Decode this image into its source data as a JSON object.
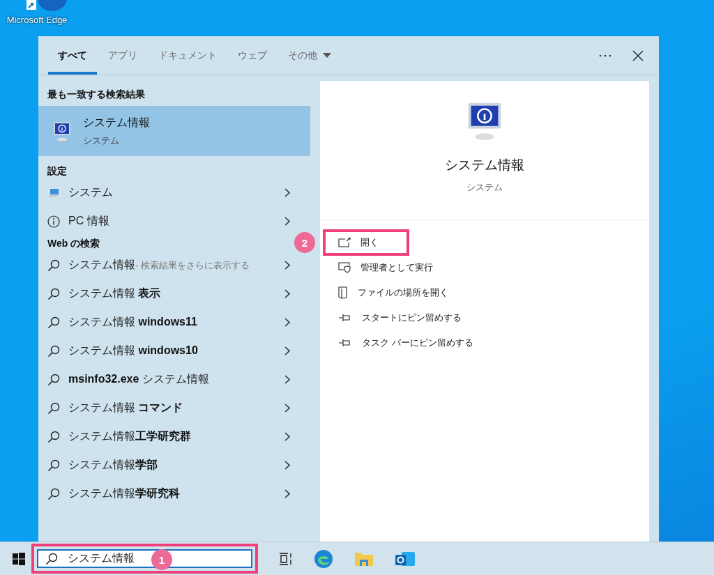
{
  "desktop_icon": {
    "label": "Microsoft Edge"
  },
  "tabs": [
    {
      "label": "すべて",
      "selected": true,
      "kind": "plain"
    },
    {
      "label": "アプリ",
      "selected": false,
      "kind": "plain"
    },
    {
      "label": "ドキュメント",
      "selected": false,
      "kind": "plain"
    },
    {
      "label": "ウェブ",
      "selected": false,
      "kind": "plain"
    },
    {
      "label": "その他",
      "selected": false,
      "kind": "dropdown"
    }
  ],
  "best_match": {
    "heading": "最も一致する検索結果",
    "title": "システム情報",
    "subtitle": "システム",
    "selected": true
  },
  "settings": {
    "heading": "設定",
    "items": [
      {
        "label": "システム",
        "kind": "laptop"
      },
      {
        "label": "PC 情報",
        "kind": "info"
      }
    ]
  },
  "web_search": {
    "heading": "Web の検索",
    "items": [
      {
        "text": "システム情報",
        "hint": "- 検索結果をさらに表示する"
      },
      {
        "text": "システム情報 **表示**"
      },
      {
        "text": "システム情報 **windows11**"
      },
      {
        "text": "システム情報 **windows10**"
      },
      {
        "text": "**msinfo32.exe** システム情報"
      },
      {
        "text": "システム情報 **コマンド**"
      },
      {
        "text": "システム情報**工学研究群**"
      },
      {
        "text": "システム情報**学部**"
      },
      {
        "text": "システム情報**学研究科**"
      }
    ]
  },
  "preview": {
    "title": "システム情報",
    "subtitle": "システム",
    "actions": [
      {
        "label": "開く",
        "kind": "open",
        "highlighted": true,
        "annotation": "2"
      },
      {
        "label": "管理者として実行",
        "kind": "admin",
        "highlighted": false
      },
      {
        "label": "ファイルの場所を開く",
        "kind": "folder",
        "highlighted": false
      },
      {
        "label": "スタートにピン留めする",
        "kind": "pin",
        "highlighted": false
      },
      {
        "label": "タスク バーにピン留めする",
        "kind": "pin",
        "highlighted": false
      }
    ]
  },
  "search_box": {
    "value": "システム情報",
    "highlighted": true,
    "annotation": "1"
  }
}
